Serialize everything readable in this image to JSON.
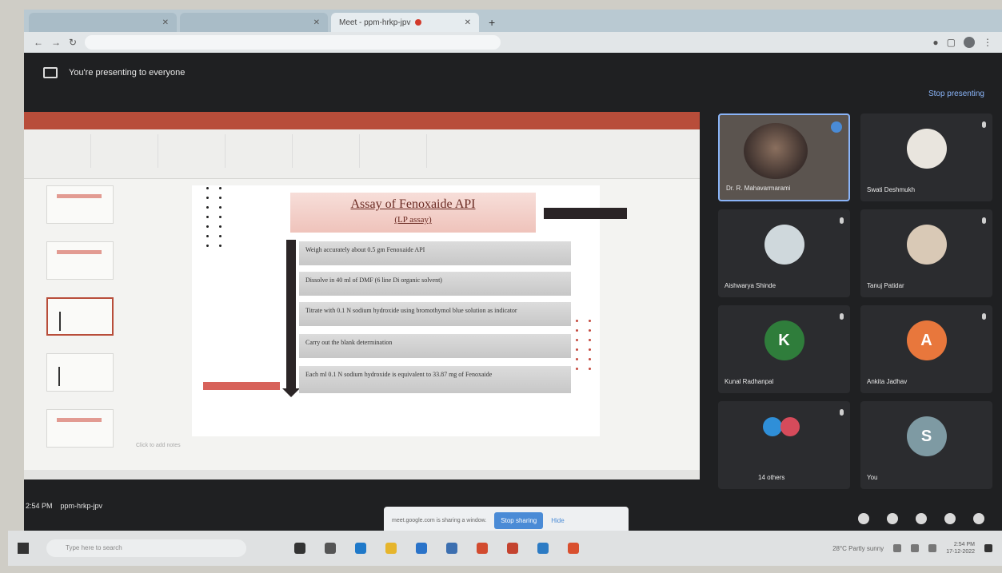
{
  "browser": {
    "tabs": [
      {
        "label": "",
        "active": false
      },
      {
        "label": "",
        "active": false
      },
      {
        "label": "Meet - ppm-hrkp-jpv",
        "active": true
      }
    ],
    "new_tab": "+",
    "url": ""
  },
  "meet": {
    "presenting_banner": "You're presenting to everyone",
    "stop_presenting": "Stop presenting",
    "time": "2:54 PM",
    "meeting_code": "ppm-hrkp-jpv",
    "stop_popup_text": "meet.google.com is sharing a window.",
    "stop_sharing": "Stop sharing",
    "hide": "Hide"
  },
  "presentation": {
    "title_line1": "Assay of Fenoxaide API",
    "title_line2": "(LP assay)",
    "steps": [
      "Weigh accurately about 0.5 gm Fenoxaide API",
      "Dissolve in 40 ml of DMF (6 line Di organic solvent)",
      "Titrate with 0.1 N sodium hydroxide using bromothymol blue solution as indicator",
      "Carry out the blank determination",
      "Each ml 0.1 N sodium hydroxide is equivalent to 33.87 mg of Fenoxaide"
    ],
    "notes_placeholder": "Click to add notes"
  },
  "participants": [
    {
      "name": "Dr. R. Mahavarmarami",
      "initial": "",
      "color": "#5b544f",
      "self": true
    },
    {
      "name": "Swati Deshmukh",
      "initial": "",
      "color": "#e9e5de"
    },
    {
      "name": "Aishwarya Shinde",
      "initial": "",
      "color": "#cfd8dc"
    },
    {
      "name": "Tanuj Patidar",
      "initial": "",
      "color": "#d9c9b6"
    },
    {
      "name": "Kunal Radhanpal",
      "initial": "K",
      "color": "#2f7d3b"
    },
    {
      "name": "Ankita Jadhav",
      "initial": "A",
      "color": "#e8773c"
    },
    {
      "name": "14 others",
      "initial": "",
      "color": ""
    },
    {
      "name": "You",
      "initial": "S",
      "color": "#7e9aa3"
    }
  ],
  "taskbar": {
    "search_placeholder": "Type here to search",
    "weather": "28°C Partly sunny",
    "clock_time": "2:54 PM",
    "clock_date": "17-12-2022"
  }
}
